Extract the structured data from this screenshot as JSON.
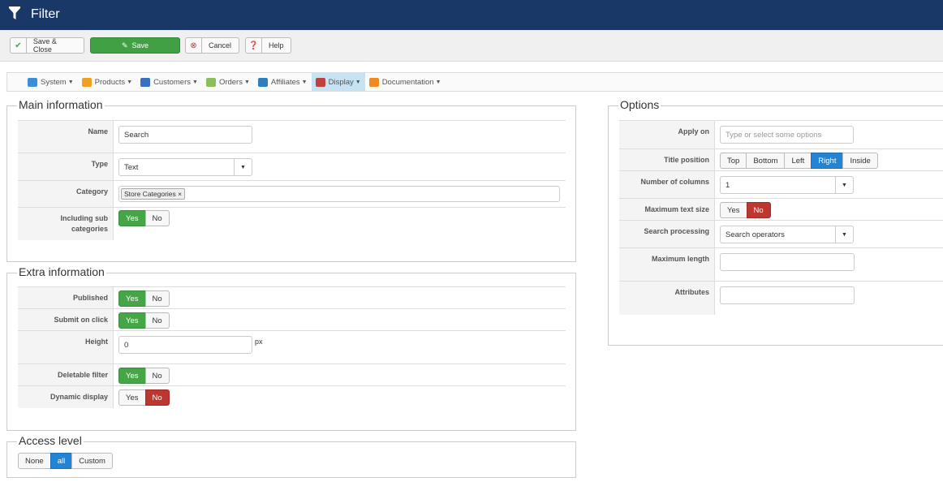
{
  "header": {
    "title": "Filter",
    "icon": "filter-icon"
  },
  "toolbar": {
    "save_close": "Save & Close",
    "save": "Save",
    "cancel": "Cancel",
    "help": "Help"
  },
  "menu": [
    {
      "label": "System",
      "color": "#3a8fd8"
    },
    {
      "label": "Products",
      "color": "#f0a020"
    },
    {
      "label": "Customers",
      "color": "#3a70c0"
    },
    {
      "label": "Orders",
      "color": "#8bbf5a"
    },
    {
      "label": "Affiliates",
      "color": "#2f7fc0"
    },
    {
      "label": "Display",
      "color": "#c04040"
    },
    {
      "label": "Documentation",
      "color": "#f08a20"
    }
  ],
  "main": {
    "legend": "Main information",
    "name_label": "Name",
    "name_value": "Search",
    "type_label": "Type",
    "type_value": "Text",
    "category_label": "Category",
    "category_tag": "Store Categories",
    "sub_label": "Including sub categories",
    "yes": "Yes",
    "no": "No"
  },
  "extra": {
    "legend": "Extra information",
    "published": "Published",
    "submit": "Submit on click",
    "height": "Height",
    "height_value": "0",
    "px": "px",
    "deletable": "Deletable filter",
    "dynamic": "Dynamic display",
    "yes": "Yes",
    "no": "No"
  },
  "access": {
    "legend": "Access level",
    "options": [
      "None",
      "all",
      "Custom"
    ],
    "selected": "all"
  },
  "options": {
    "legend": "Options",
    "apply_on": "Apply on",
    "apply_placeholder": "Type or select some options",
    "title_position": "Title position",
    "positions": [
      "Top",
      "Bottom",
      "Left",
      "Right",
      "Inside"
    ],
    "position_selected": "Right",
    "columns": "Number of columns",
    "columns_value": "1",
    "max_text": "Maximum text size",
    "yes": "Yes",
    "no": "No",
    "search_proc": "Search processing",
    "search_value": "Search operators",
    "max_length": "Maximum length",
    "attributes": "Attributes"
  }
}
